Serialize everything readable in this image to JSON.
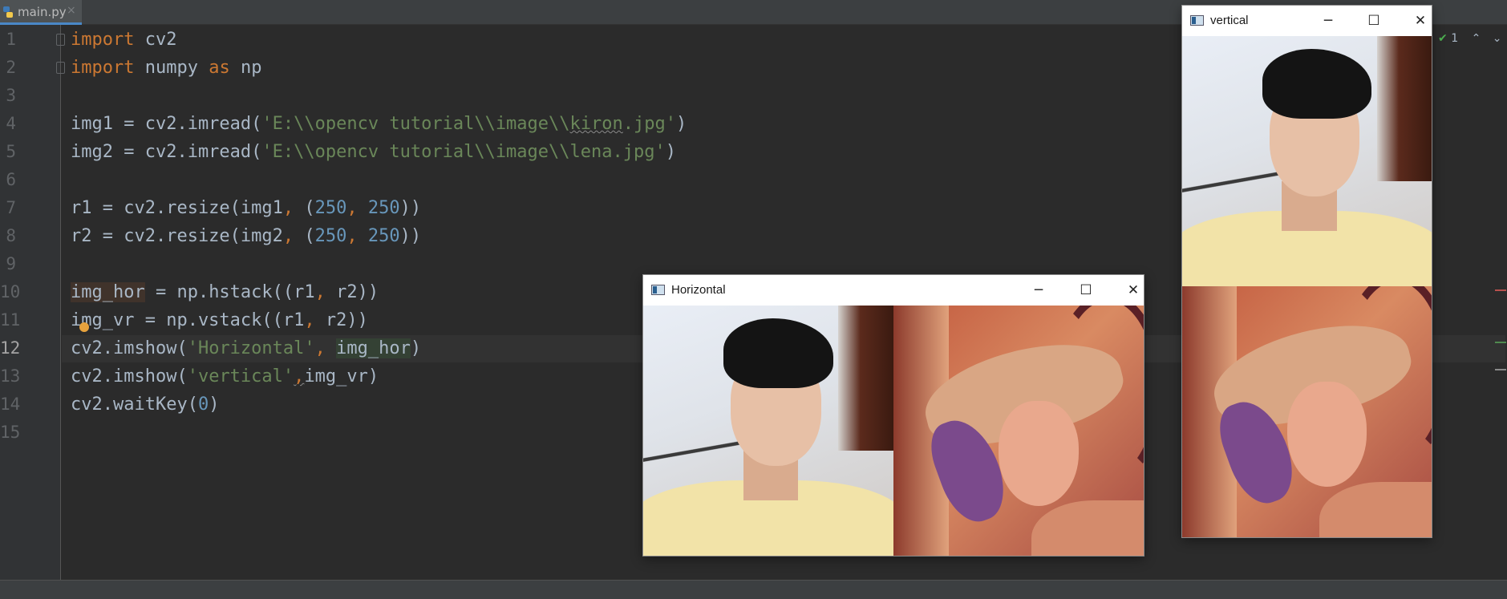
{
  "tab": {
    "label": "main.py",
    "close": "×"
  },
  "editor": {
    "line_numbers": [
      "1",
      "2",
      "3",
      "4",
      "5",
      "6",
      "7",
      "8",
      "9",
      "10",
      "11",
      "12",
      "13",
      "14",
      "15"
    ],
    "current_line": "12",
    "code_lines": [
      "import cv2",
      "import numpy as np",
      "",
      "img1 = cv2.imread('E:\\\\opencv tutorial\\\\image\\\\kiron.jpg')",
      "img2 = cv2.imread('E:\\\\opencv tutorial\\\\image\\\\lena.jpg')",
      "",
      "r1 = cv2.resize(img1, (250, 250))",
      "r2 = cv2.resize(img2, (250, 250))",
      "",
      "img_hor = np.hstack((r1, r2))",
      "img_vr = np.vstack((r1, r2))",
      "cv2.imshow('Horizontal', img_hor)",
      "cv2.imshow('vertical',img_vr)",
      "cv2.waitKey(0)",
      ""
    ],
    "inspection_count": "1"
  },
  "horizontal_window": {
    "title": "Horizontal",
    "images": [
      "kiron-image",
      "lena-image"
    ]
  },
  "vertical_window": {
    "title": "vertical",
    "images": [
      "kiron-image",
      "lena-image"
    ]
  },
  "window_controls": {
    "minimize": "─",
    "maximize": "☐",
    "close": "✕"
  },
  "colors": {
    "editor_bg": "#2b2b2b",
    "keyword": "#cc7832",
    "string": "#6a8759",
    "number": "#6897bb",
    "identifier": "#a9b7c6"
  }
}
